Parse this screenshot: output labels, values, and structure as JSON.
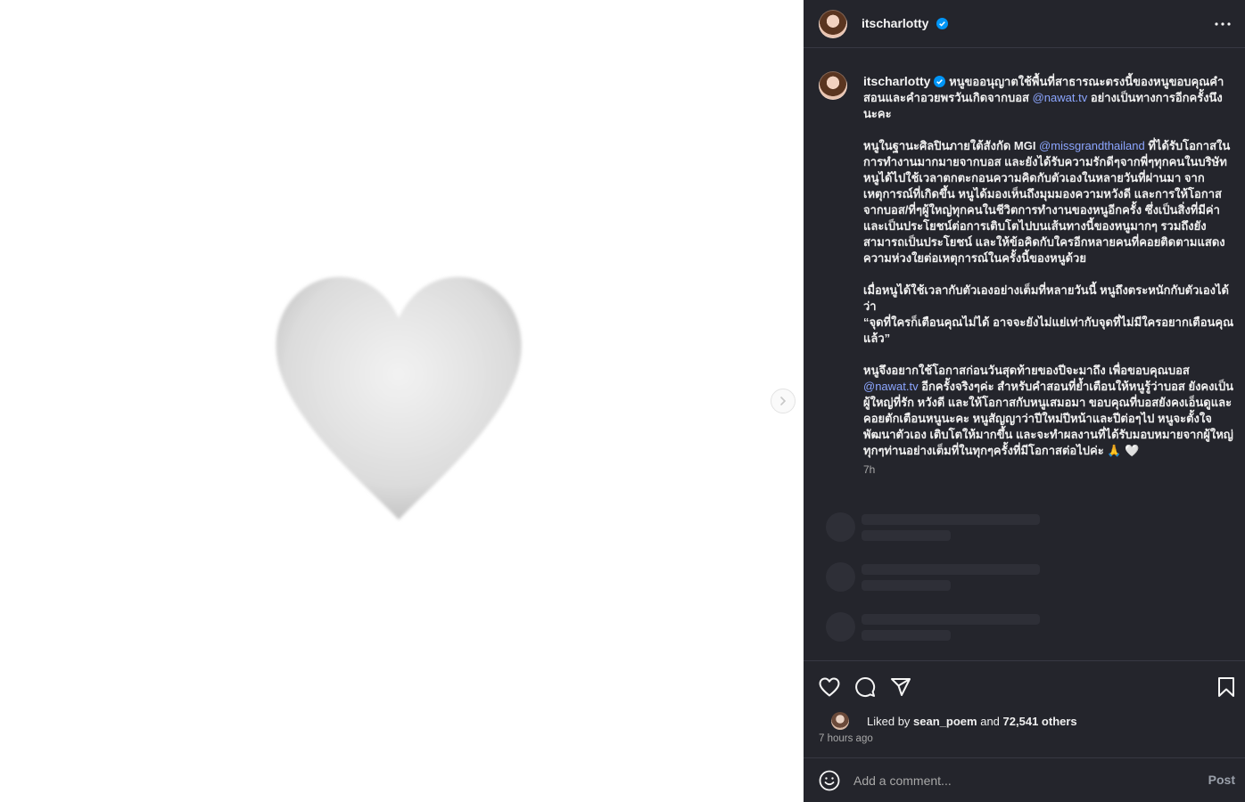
{
  "post": {
    "username": "itscharlotty",
    "more_icon": "more-horizontal-icon",
    "caption": {
      "p1_a": "หนูขออนุญาตใช้พื้นที่สาธารณะตรงนี้ของหนูขอบคุณคำสอนและคำอวยพรวันเกิดจากบอส ",
      "p1_mention": "@nawat.tv",
      "p1_b": " อย่างเป็นทางการอีกครั้งนึงนะคะ",
      "p2_a": "หนูในฐานะศิลปินภายใต้สังกัด MGI ",
      "p2_mention": "@missgrandthailand",
      "p2_b": " ที่ได้รับโอกาสในการทำงานมากมายจากบอส และยังได้รับความรักดีๆจากพี่ๆทุกคนในบริษัท หนูได้ไปใช้เวลาตกตะกอนความคิดกับตัวเองในหลายวันที่ผ่านมา จากเหตุการณ์ที่เกิดขึ้น หนูได้มองเห็นถึงมุมมองความหวังดี และการให้โอกาสจากบอส/ที่ๆผู้ใหญ่ทุกคนในชีวิตการทำงานของหนูอีกครั้ง ซึ่งเป็นสิ่งที่มีค่า และเป็นประโยชน์ต่อการเติบโตไปบนเส้นทางนี้ของหนูมากๆ รวมถึงยังสามารถเป็นประโยชน์ และให้ข้อคิดกับใครอีกหลายคนที่คอยติดตามแสดงความห่วงใยต่อเหตุการณ์ในครั้งนี้ของหนูด้วย",
      "p3_a": "เมื่อหนูได้ใช้เวลากับตัวเองอย่างเต็มที่หลายวันนี้ หนูถึงตระหนักกับตัวเองได้ว่า",
      "p3_quote": "“จุดที่ใครก็เตือนคุณไม่ได้ อาจจะยังไม่แย่เท่ากับจุดที่ไม่มีใครอยากเตือนคุณแล้ว”",
      "p4_a": "หนูจึงอยากใช้โอกาสก่อนวันสุดท้ายของปีจะมาถึง เพื่อขอบคุณบอส ",
      "p4_mention": "@nawat.tv",
      "p4_b": " อีกครั้งจริงๆค่ะ สำหรับคำสอนที่ย้ำเตือนให้หนูรู้ว่าบอส ยังคงเป็นผู้ใหญ่ที่รัก หวังดี และให้โอกาสกับหนูเสมอมา ขอบคุณที่บอสยังคงเอ็นดูและคอยตักเตือนหนูนะคะ หนูสัญญาว่าปีใหม่ปีหน้าและปีต่อๆไป หนูจะตั้งใจพัฒนาตัวเอง เติบโตให้มากขึ้น และจะทำผลงานที่ได้รับมอบหมายจากผู้ใหญ่ทุกๆท่านอย่างเต็มที่ในทุกๆครั้งที่มีโอกาสต่อไปค่ะ 🙏 🤍"
    },
    "time_short": "7h",
    "likes": {
      "prefix": "Liked by ",
      "user": "sean_poem",
      "middle": " and ",
      "count": "72,541 others"
    },
    "posted_ago": "7 hours ago",
    "comment": {
      "placeholder": "Add a comment...",
      "post_label": "Post"
    }
  },
  "colors": {
    "panel_bg": "#24252c",
    "divider": "#373843",
    "mention": "#8ca6ff",
    "verified": "#0095f6",
    "heart": "#d9d9d9"
  },
  "icons": {
    "media": "white-heart-icon",
    "next": "chevron-right-icon",
    "actions": [
      "like-icon",
      "comment-icon",
      "share-icon",
      "save-icon"
    ],
    "emoji": "emoji-icon"
  }
}
